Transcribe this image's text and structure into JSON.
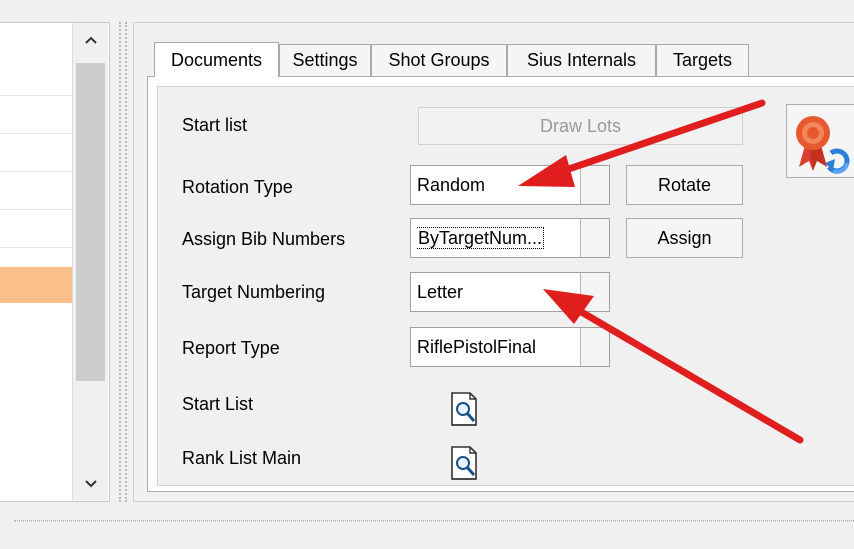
{
  "left_list": {
    "scroll_up_glyph": "^",
    "scroll_down_glyph": "v",
    "selected_color": "#fbbf8b"
  },
  "tabs": [
    {
      "label": "Documents",
      "active": true
    },
    {
      "label": "Settings",
      "active": false
    },
    {
      "label": "Shot Groups",
      "active": false
    },
    {
      "label": "Sius Internals",
      "active": false
    },
    {
      "label": "Targets",
      "active": false
    }
  ],
  "documents": {
    "start_list_label": "Start list",
    "draw_lots_button": "Draw Lots",
    "rotation_type_label": "Rotation Type",
    "rotation_type_value": "Random",
    "rotate_button": "Rotate",
    "assign_bib_label": "Assign Bib Numbers",
    "assign_bib_value": "ByTargetNum...",
    "assign_button": "Assign",
    "target_numbering_label": "Target Numbering",
    "target_numbering_value": "Letter",
    "report_type_label": "Report Type",
    "report_type_value": "RiflePistolFinal",
    "start_list_report_label": "Start List",
    "rank_list_main_label": "Rank List Main"
  },
  "icons": {
    "preview": "print-preview-icon",
    "award": "award-refresh-icon"
  },
  "colors": {
    "annotation_arrow": "#e01e1e",
    "selected_row": "#fbbf8b"
  }
}
